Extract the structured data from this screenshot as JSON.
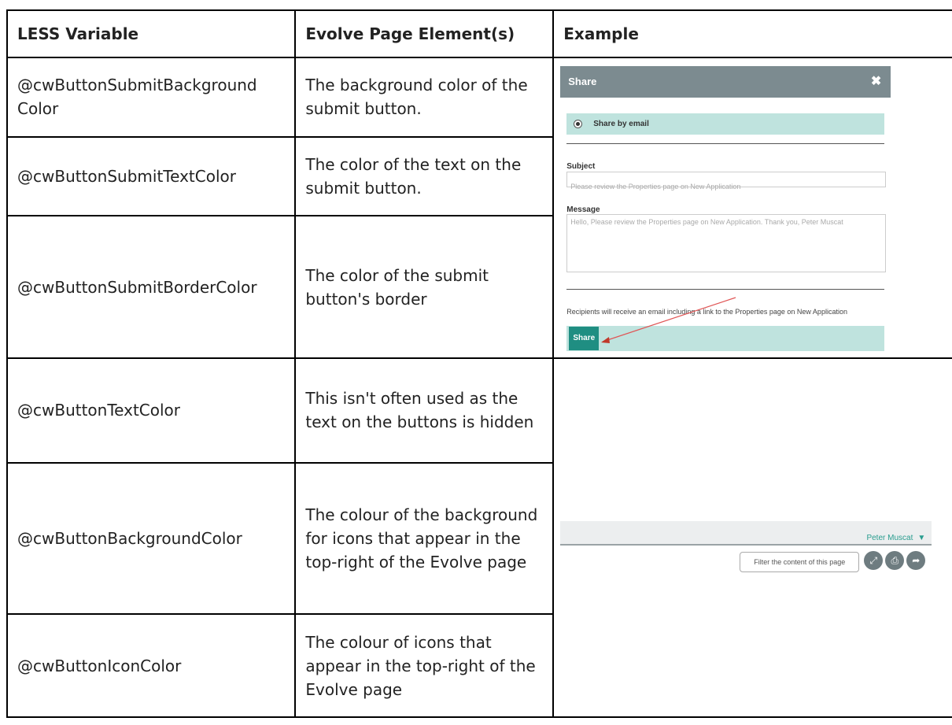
{
  "headers": [
    "LESS Variable",
    "Evolve Page Element(s)",
    "Example"
  ],
  "rows": [
    {
      "variable": "@cwButtonSubmitBackground\nColor",
      "description": "The background color of the submit button."
    },
    {
      "variable": "@cwButtonSubmitTextColor",
      "description": "The color of the text on the submit button."
    },
    {
      "variable": "@cwButtonSubmitBorderColor",
      "description": "The color of the submit button's border"
    },
    {
      "variable": "@cwButtonTextColor",
      "description": "This isn't often used as the text on the buttons is hidden"
    },
    {
      "variable": "@cwButtonBackgroundColor",
      "description": "The colour of the background for icons that appear in the top-right of the Evolve page"
    },
    {
      "variable": "@cwButtonIconColor",
      "description": "The colour of icons that appear in the top-right of the Evolve page"
    }
  ],
  "share_example": {
    "title": "Share",
    "close_icon": "close-icon",
    "option": "Share by email",
    "subject_label": "Subject",
    "subject_value": "Please review the Properties page on New Application",
    "message_label": "Message",
    "message_value": "Hello, Please review the Properties page on New Application. Thank you, Peter Muscat",
    "recipients_note": "Recipients will receive an email including a link to the Properties page on New Application",
    "share_button": "Share",
    "colors": {
      "header": "#7c8b90",
      "band": "#bfe3de",
      "button": "#1f8e82",
      "arrow": "#e05555"
    }
  },
  "toolbar_example": {
    "user": "Peter Muscat",
    "filter_placeholder": "Filter the content of this page",
    "icons": [
      "expand-icon",
      "print-icon",
      "share-icon"
    ],
    "colors": {
      "icon_bg": "#6e7c80",
      "user_text": "#2a9d8f"
    }
  }
}
